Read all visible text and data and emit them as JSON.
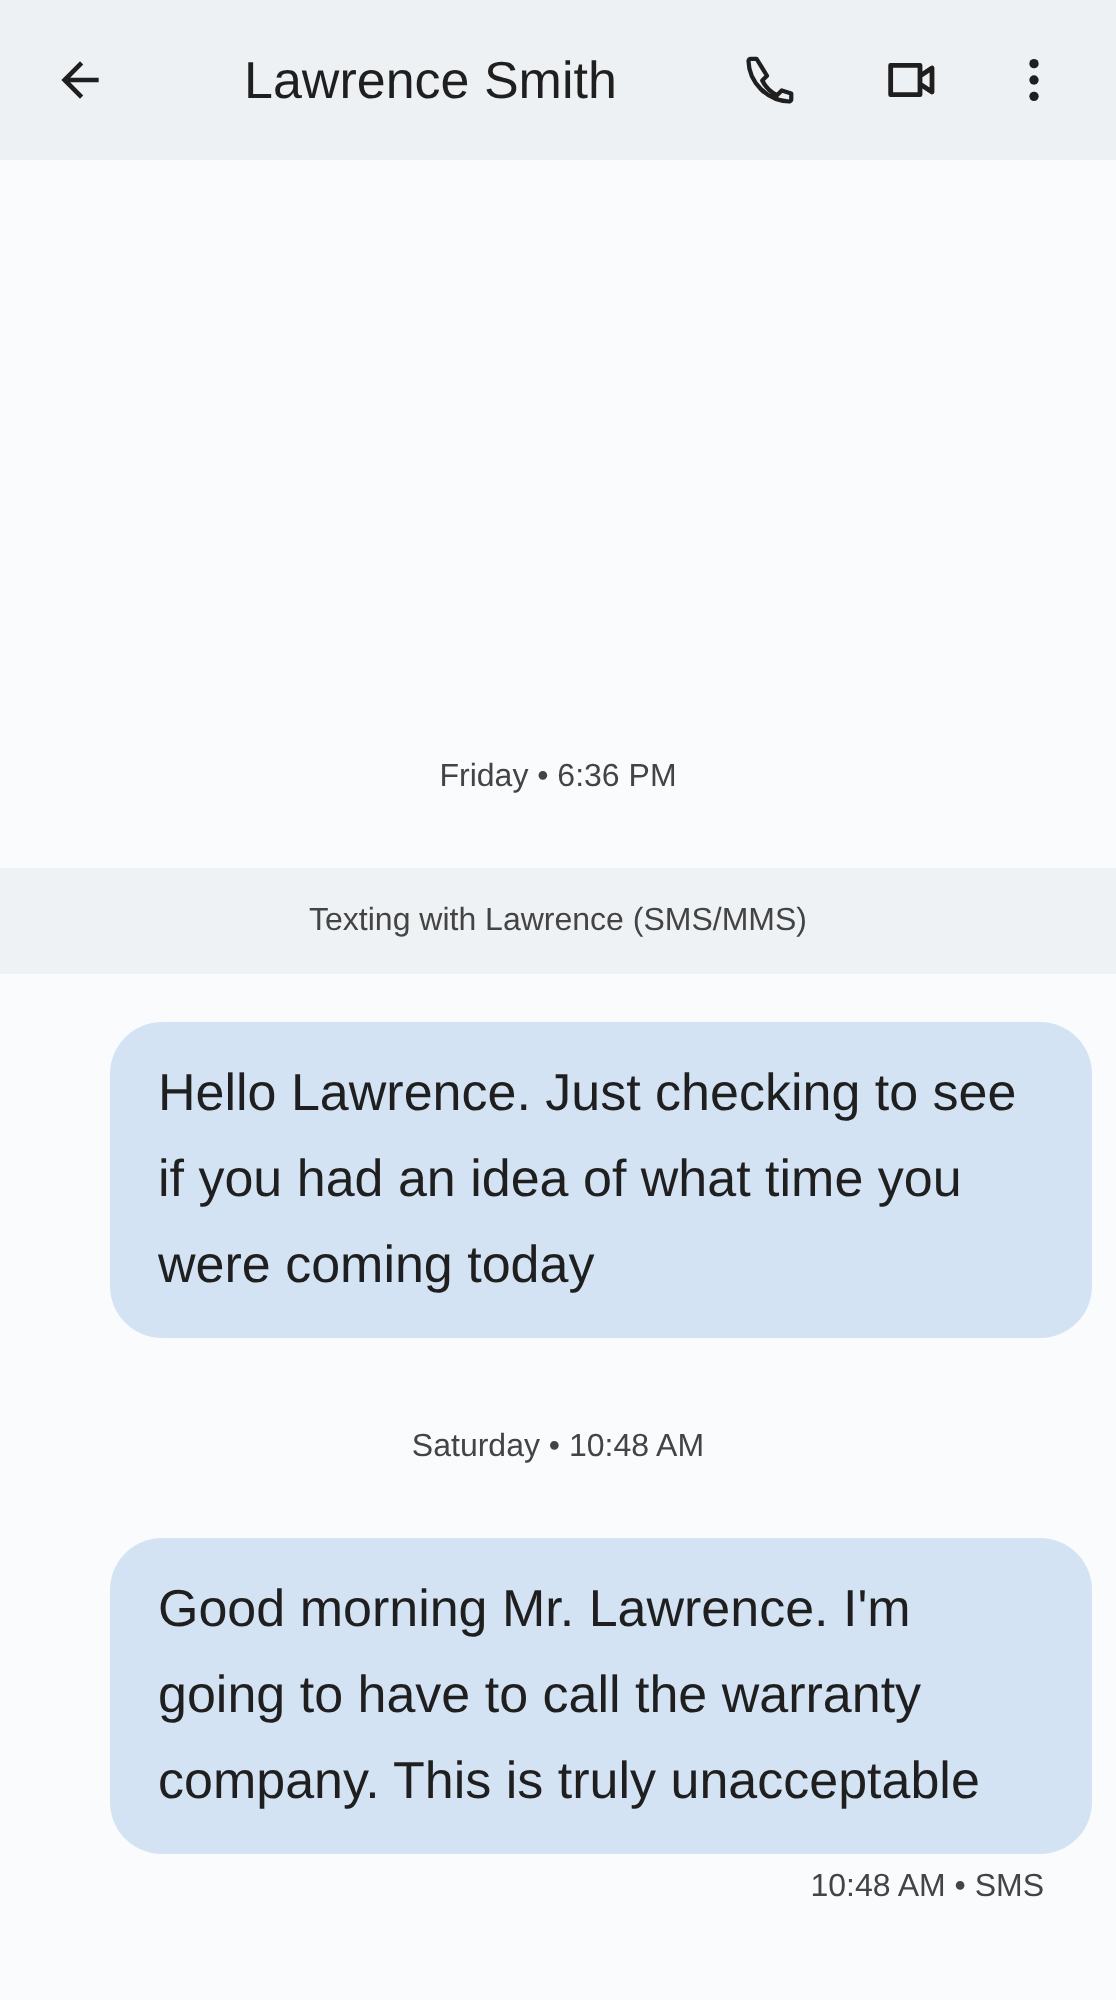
{
  "header": {
    "title": "Lawrence Smith"
  },
  "thread": [
    {
      "kind": "timestamp",
      "text": "Friday • 6:36 PM"
    },
    {
      "kind": "banner",
      "text": "Texting with Lawrence (SMS/MMS)"
    },
    {
      "kind": "outgoing",
      "text": "Hello Lawrence. Just checking to see if you had an idea of what time you were coming today"
    },
    {
      "kind": "timestamp",
      "text": "Saturday • 10:48 AM"
    },
    {
      "kind": "outgoing",
      "text": "Good morning Mr. Lawrence. I'm going to have to call the warranty company. This is truly unacceptable"
    },
    {
      "kind": "status",
      "text": "10:48 AM • SMS"
    }
  ]
}
